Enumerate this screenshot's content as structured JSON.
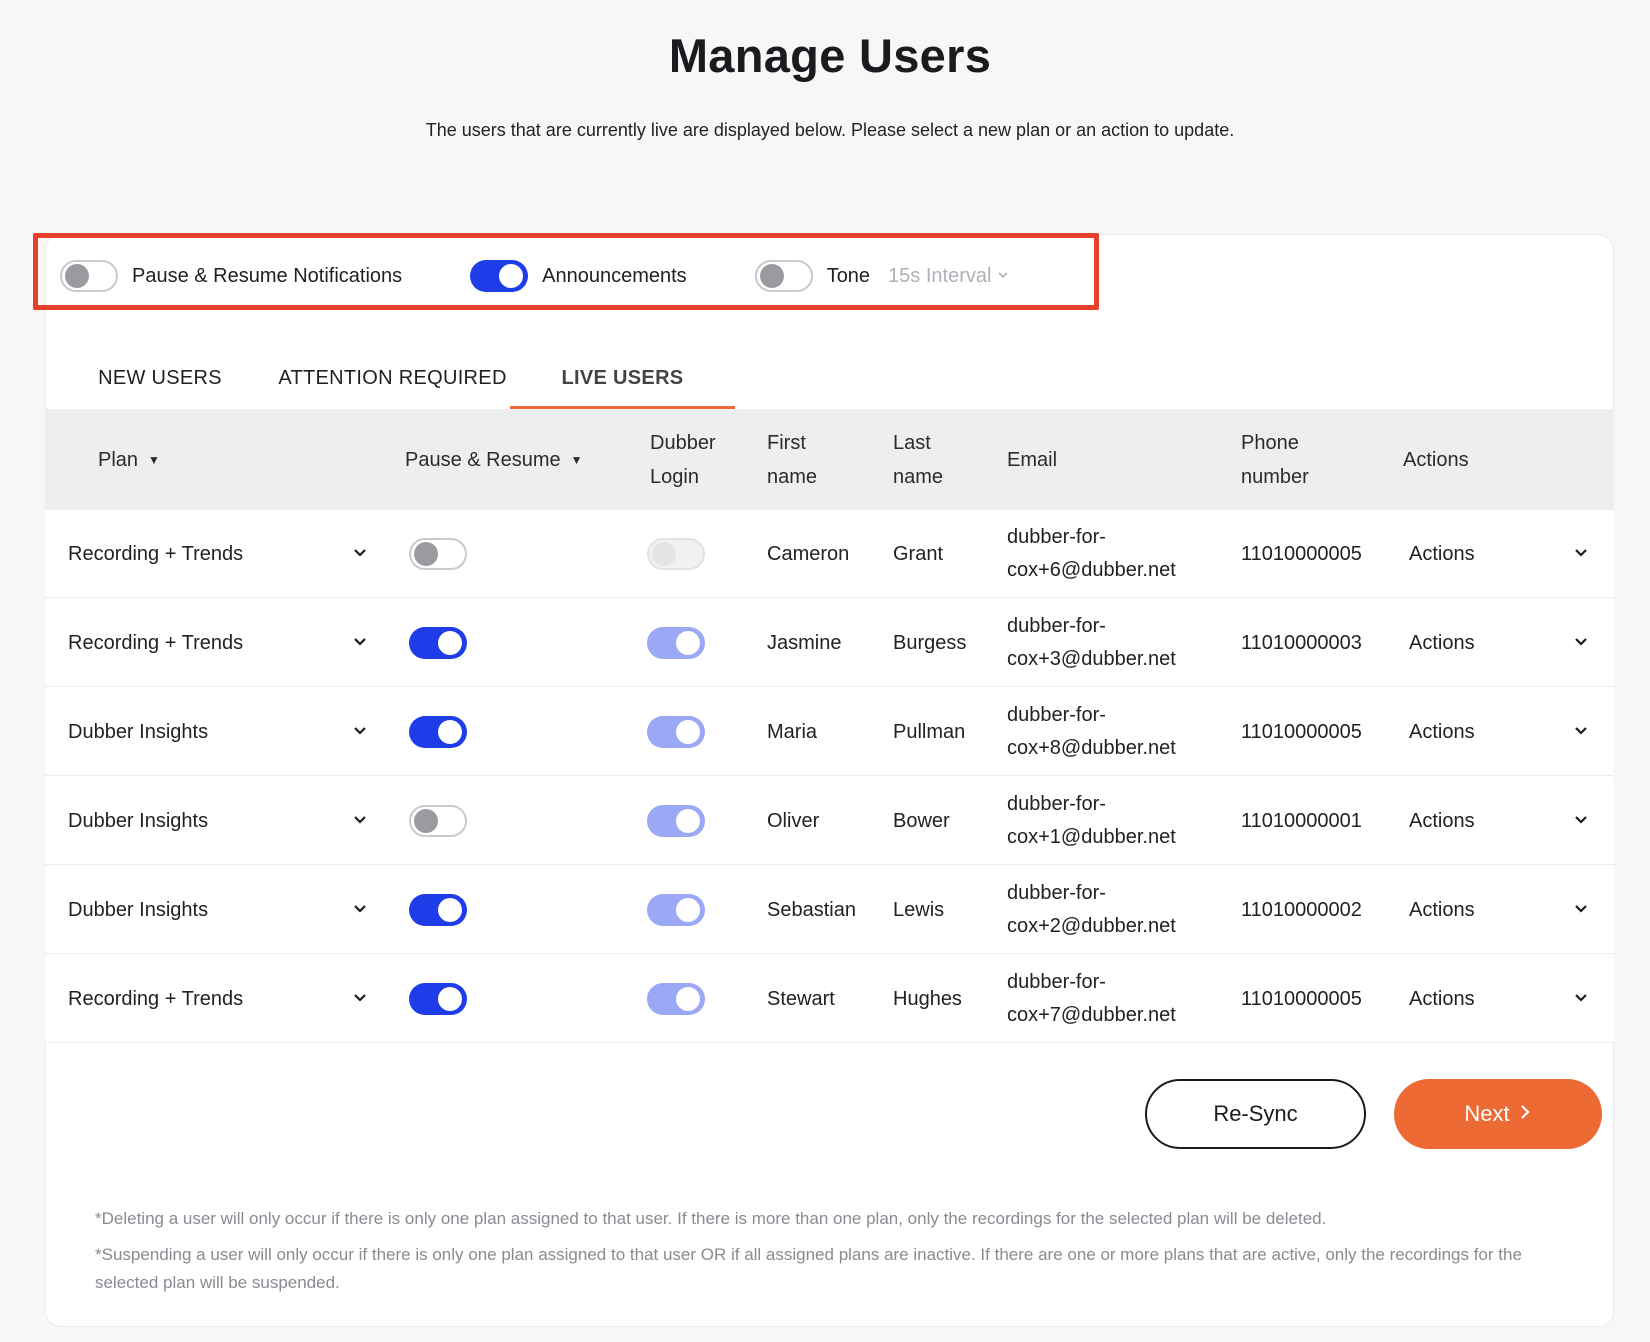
{
  "header": {
    "title": "Manage Users",
    "subtitle": "The users that are currently live are displayed below. Please select a new plan or an action to update."
  },
  "settings": {
    "pause_resume": {
      "label": "Pause & Resume Notifications",
      "enabled": false
    },
    "announcements": {
      "label": "Announcements",
      "enabled": true
    },
    "tone": {
      "label": "Tone",
      "enabled": false,
      "interval": "15s Interval"
    }
  },
  "tabs": [
    {
      "label": "NEW USERS",
      "active": false
    },
    {
      "label": "ATTENTION REQUIRED",
      "active": false
    },
    {
      "label": "LIVE USERS",
      "active": true
    }
  ],
  "table": {
    "headers": {
      "plan": "Plan",
      "pause_resume": "Pause & Resume",
      "dubber_login_1": "Dubber",
      "dubber_login_2": "Login",
      "first_name_1": "First",
      "first_name_2": "name",
      "last_name_1": "Last",
      "last_name_2": "name",
      "email": "Email",
      "phone_1": "Phone",
      "phone_2": "number",
      "actions": "Actions"
    },
    "rows": [
      {
        "plan": "Recording + Trends",
        "pause": "off",
        "login": "disabled",
        "first": "Cameron",
        "last": "Grant",
        "email_1": "dubber-for-",
        "email_2": "cox+6@dubber.net",
        "phone": "11010000005",
        "actions": "Actions"
      },
      {
        "plan": "Recording + Trends",
        "pause": "on",
        "login": "on-light",
        "first": "Jasmine",
        "last": "Burgess",
        "email_1": "dubber-for-",
        "email_2": "cox+3@dubber.net",
        "phone": "11010000003",
        "actions": "Actions"
      },
      {
        "plan": "Dubber Insights",
        "pause": "on",
        "login": "on-light",
        "first": "Maria",
        "last": "Pullman",
        "email_1": "dubber-for-",
        "email_2": "cox+8@dubber.net",
        "phone": "11010000005",
        "actions": "Actions"
      },
      {
        "plan": "Dubber Insights",
        "pause": "off",
        "login": "on-light",
        "first": "Oliver",
        "last": "Bower",
        "email_1": "dubber-for-",
        "email_2": "cox+1@dubber.net",
        "phone": "11010000001",
        "actions": "Actions"
      },
      {
        "plan": "Dubber Insights",
        "pause": "on",
        "login": "on-light",
        "first": "Sebastian",
        "last": "Lewis",
        "email_1": "dubber-for-",
        "email_2": "cox+2@dubber.net",
        "phone": "11010000002",
        "actions": "Actions"
      },
      {
        "plan": "Recording + Trends",
        "pause": "on",
        "login": "on-light",
        "first": "Stewart",
        "last": "Hughes",
        "email_1": "dubber-for-",
        "email_2": "cox+7@dubber.net",
        "phone": "11010000005",
        "actions": "Actions"
      }
    ]
  },
  "buttons": {
    "resync": "Re-Sync",
    "next": "Next"
  },
  "footnotes": {
    "delete": "*Deleting a user will only occur if there is only one plan assigned to that user. If there is more than one plan, only the recordings for the selected plan will be deleted.",
    "suspend": "*Suspending a user will only occur if there is only one plan assigned to that user OR if all assigned plans are inactive. If there are one or more plans that are active, only the recordings for the selected plan will be suspended."
  },
  "colors": {
    "accent_orange": "#ee6a34",
    "toggle_blue": "#1e3de8",
    "toggle_blue_light": "#9aa8f5",
    "highlight_red": "#e8402a"
  }
}
